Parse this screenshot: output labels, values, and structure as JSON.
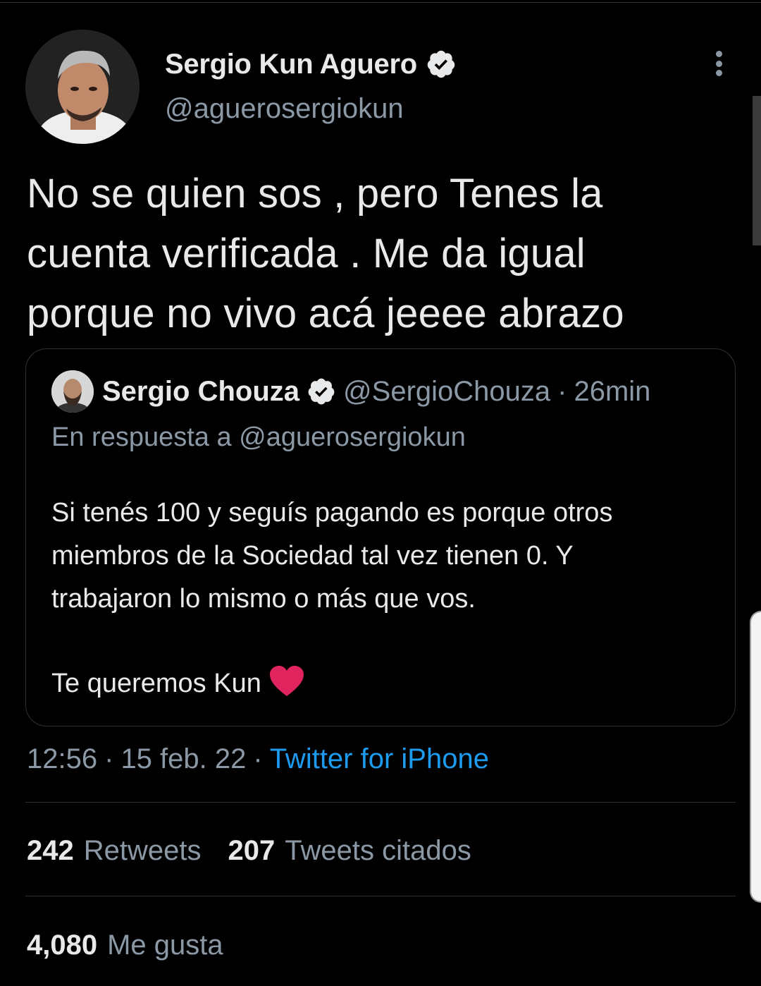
{
  "tweet": {
    "author": {
      "display_name": "Sergio Kun Aguero",
      "handle": "@aguerosergiokun",
      "verified_icon": "verified-badge-icon"
    },
    "text_lines": [
      "No se quien sos , pero Tenes la",
      "cuenta verificada . Me da igual",
      "porque no vivo acá jeeee abrazo"
    ],
    "menu_icon": "more-vertical-icon"
  },
  "quoted_tweet": {
    "display_name": "Sergio Chouza",
    "handle": "@SergioChouza",
    "separator": "·",
    "time": "26min",
    "reply_to": "En respuesta a @aguerosergiokun",
    "lines": [
      "Si tenés 100 y seguís pagando es porque otros",
      "miembros de la Sociedad tal vez tienen 0. Y",
      "trabajaron lo mismo o más que vos."
    ],
    "closing": "Te queremos Kun",
    "emoji": "red-heart-icon"
  },
  "meta": {
    "time": "12:56",
    "sep1": "·",
    "date": "15 feb. 22",
    "sep2": "·",
    "source": "Twitter for iPhone"
  },
  "stats": {
    "retweets_count": "242",
    "retweets_label": "Retweets",
    "quotes_count": "207",
    "quotes_label": "Tweets citados",
    "likes_count": "4,080",
    "likes_label": "Me gusta"
  },
  "colors": {
    "background": "#000000",
    "text": "#e7e9ea",
    "muted": "#8b98a5",
    "link": "#1d9bf0",
    "border": "#2f3336",
    "heart": "#e0245e"
  }
}
